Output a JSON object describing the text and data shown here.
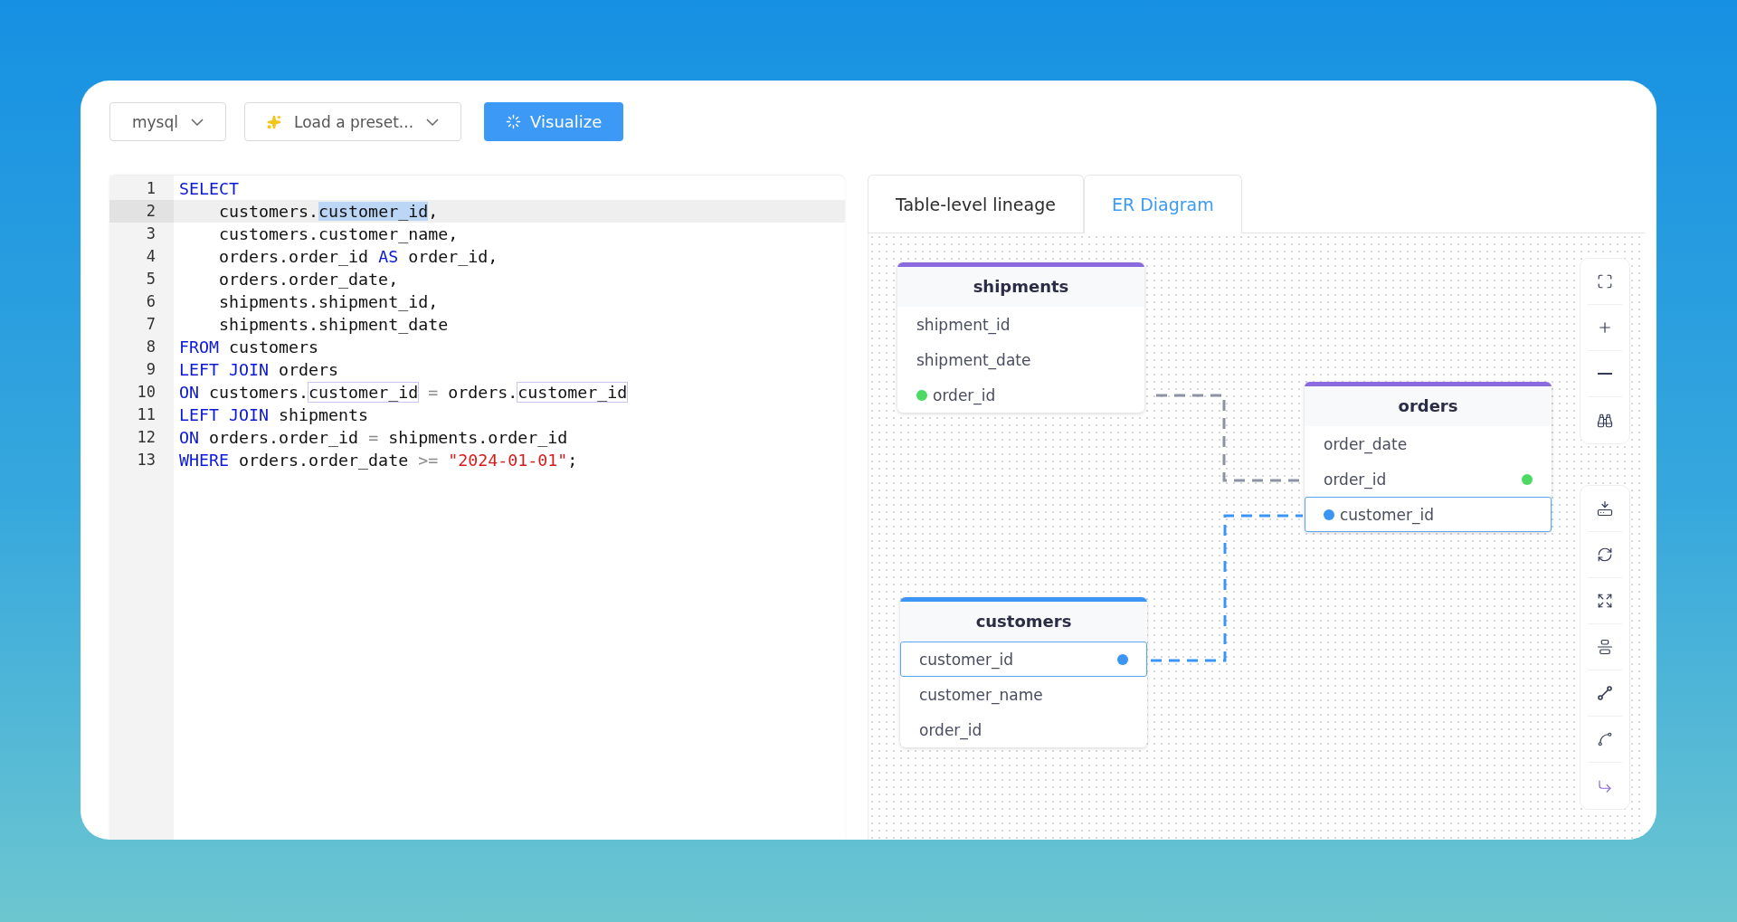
{
  "toolbar": {
    "dialect": "mysql",
    "preset": "Load a preset...",
    "action": "Visualize"
  },
  "editor": {
    "lines": [
      {
        "number": "1",
        "active": false,
        "tokens": [
          {
            "text": "SELECT",
            "kind": "keyword"
          }
        ]
      },
      {
        "number": "2",
        "active": true,
        "tokens": [
          {
            "text": "    customers.",
            "kind": "text"
          },
          {
            "text": "customer_id",
            "kind": "selected"
          },
          {
            "text": ",",
            "kind": "text"
          }
        ]
      },
      {
        "number": "3",
        "active": false,
        "tokens": [
          {
            "text": "    customers.customer_name,",
            "kind": "text"
          }
        ]
      },
      {
        "number": "4",
        "active": false,
        "tokens": [
          {
            "text": "    orders.order_id ",
            "kind": "text"
          },
          {
            "text": "AS",
            "kind": "keyword"
          },
          {
            "text": " order_id,",
            "kind": "text"
          }
        ]
      },
      {
        "number": "5",
        "active": false,
        "tokens": [
          {
            "text": "    orders.order_date,",
            "kind": "text"
          }
        ]
      },
      {
        "number": "6",
        "active": false,
        "tokens": [
          {
            "text": "    shipments.shipment_id,",
            "kind": "text"
          }
        ]
      },
      {
        "number": "7",
        "active": false,
        "tokens": [
          {
            "text": "    shipments.shipment_date",
            "kind": "text"
          }
        ]
      },
      {
        "number": "8",
        "active": false,
        "tokens": [
          {
            "text": "FROM",
            "kind": "keyword"
          },
          {
            "text": " customers",
            "kind": "text"
          }
        ]
      },
      {
        "number": "9",
        "active": false,
        "tokens": [
          {
            "text": "LEFT JOIN",
            "kind": "keyword"
          },
          {
            "text": " orders",
            "kind": "text"
          }
        ]
      },
      {
        "number": "10",
        "active": false,
        "tokens": [
          {
            "text": "ON",
            "kind": "keyword"
          },
          {
            "text": " customers.",
            "kind": "text"
          },
          {
            "text": "customer_id",
            "kind": "matched"
          },
          {
            "text": " =",
            "kind": "operator"
          },
          {
            "text": " orders.",
            "kind": "text"
          },
          {
            "text": "customer_id",
            "kind": "matched"
          }
        ]
      },
      {
        "number": "11",
        "active": false,
        "tokens": [
          {
            "text": "LEFT JOIN",
            "kind": "keyword"
          },
          {
            "text": " shipments",
            "kind": "text"
          }
        ]
      },
      {
        "number": "12",
        "active": false,
        "tokens": [
          {
            "text": "ON",
            "kind": "keyword"
          },
          {
            "text": " orders.order_id ",
            "kind": "text"
          },
          {
            "text": "=",
            "kind": "operator"
          },
          {
            "text": " shipments.order_id",
            "kind": "text"
          }
        ]
      },
      {
        "number": "13",
        "active": false,
        "tokens": [
          {
            "text": "WHERE",
            "kind": "keyword"
          },
          {
            "text": " orders.order_date ",
            "kind": "text"
          },
          {
            "text": ">=",
            "kind": "operator"
          },
          {
            "text": " \"2024-01-01\"",
            "kind": "string"
          },
          {
            "text": ";",
            "kind": "text"
          }
        ]
      }
    ]
  },
  "tabs": [
    {
      "label": "Table-level lineage",
      "selected": false
    },
    {
      "label": "ER Diagram",
      "selected": true
    }
  ],
  "diagram": {
    "tables": [
      {
        "name": "shipments",
        "color": "#8b6ae0",
        "columns": [
          {
            "name": "shipment_id",
            "selected": false
          },
          {
            "name": "shipment_date",
            "selected": false
          },
          {
            "name": "order_id",
            "selected": false,
            "kind": "leftdot",
            "color": "#4cd964"
          }
        ]
      },
      {
        "name": "orders",
        "color": "#8b6ae0",
        "columns": [
          {
            "name": "order_date",
            "selected": false
          },
          {
            "name": "order_id",
            "selected": false,
            "kind": "rightdot",
            "color": "#4cd964"
          },
          {
            "name": "customer_id",
            "selected": true,
            "kind": "leftdot",
            "color": "#3b95f5"
          }
        ]
      },
      {
        "name": "customers",
        "color": "#3b95f5",
        "columns": [
          {
            "name": "customer_id",
            "selected": true,
            "kind": "rightdot",
            "color": "#3b95f5"
          },
          {
            "name": "customer_name",
            "selected": false
          },
          {
            "name": "order_id",
            "selected": false
          }
        ]
      }
    ],
    "edges": [
      {
        "color": "#8e93a3"
      },
      {
        "color": "#3b95f5"
      }
    ]
  }
}
